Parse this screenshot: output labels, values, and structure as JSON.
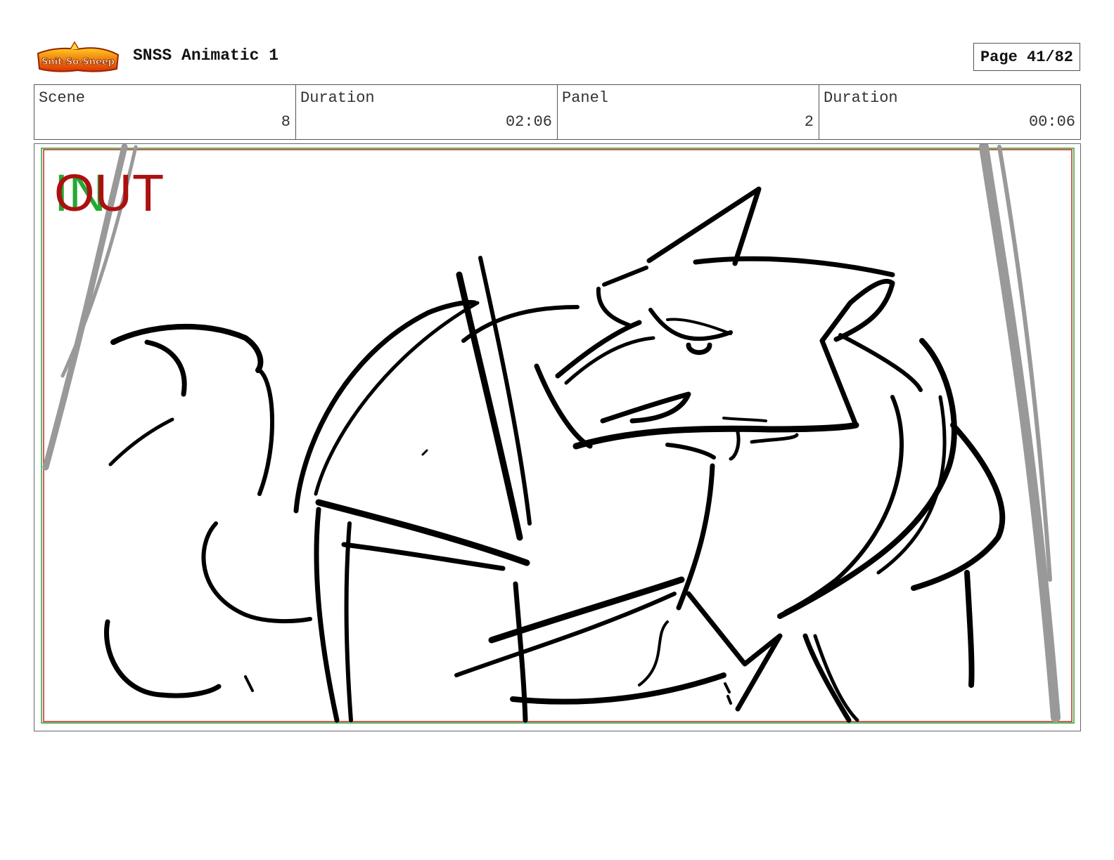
{
  "header": {
    "logo_text": "Snit-So-Sneep",
    "title": "SNSS Animatic 1",
    "page": "Page 41/82"
  },
  "info": {
    "scene_label": "Scene",
    "scene_value": "8",
    "scene_duration_label": "Duration",
    "scene_duration_value": "02:06",
    "panel_label": "Panel",
    "panel_value": "2",
    "panel_duration_label": "Duration",
    "panel_duration_value": "00:06"
  },
  "panel": {
    "in_marker": "IN",
    "out_marker": "OUT",
    "in_color": "#22aa33",
    "out_color": "#aa1111",
    "safe_frame_color": "#cc2222",
    "sketch_color": "#000000",
    "curtain_color": "#999999"
  }
}
